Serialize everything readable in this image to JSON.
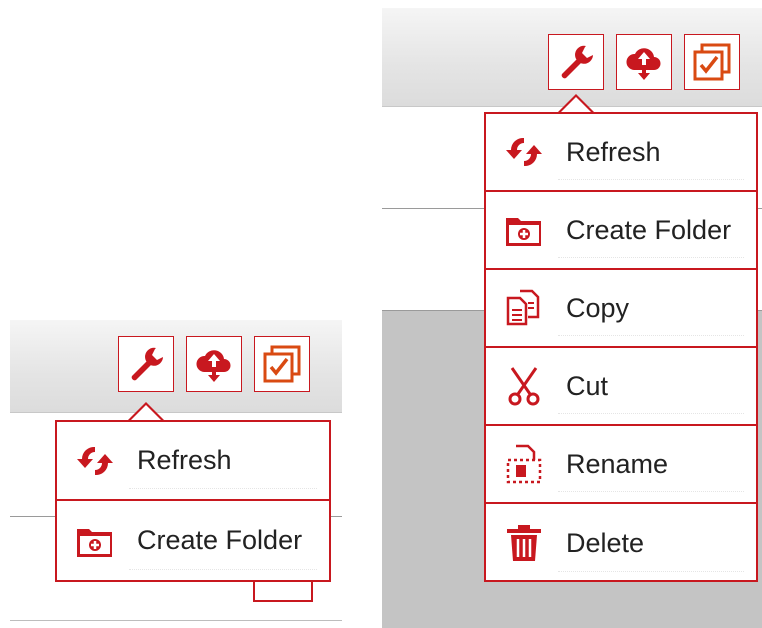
{
  "colors": {
    "accent": "#c8181f",
    "accent_orange": "#d94a12",
    "toolbar_bg": "#e6e6e6",
    "content_gray": "#c4c4c4"
  },
  "left_panel": {
    "toolbar": [
      {
        "icon": "wrench-icon",
        "name": "tools"
      },
      {
        "icon": "cloud-upload-download-icon",
        "name": "transfer"
      },
      {
        "icon": "multi-select-checkbox-icon",
        "name": "select"
      }
    ],
    "menu": [
      {
        "label": "Refresh",
        "icon": "refresh-icon"
      },
      {
        "label": "Create Folder",
        "icon": "create-folder-icon"
      }
    ]
  },
  "right_panel": {
    "toolbar": [
      {
        "icon": "wrench-icon",
        "name": "tools"
      },
      {
        "icon": "cloud-upload-download-icon",
        "name": "transfer"
      },
      {
        "icon": "multi-select-checkbox-icon",
        "name": "select"
      }
    ],
    "menu": [
      {
        "label": "Refresh",
        "icon": "refresh-icon"
      },
      {
        "label": "Create Folder",
        "icon": "create-folder-icon"
      },
      {
        "label": "Copy",
        "icon": "copy-icon"
      },
      {
        "label": "Cut",
        "icon": "scissors-icon"
      },
      {
        "label": "Rename",
        "icon": "rename-icon"
      },
      {
        "label": "Delete",
        "icon": "trash-icon"
      }
    ]
  }
}
